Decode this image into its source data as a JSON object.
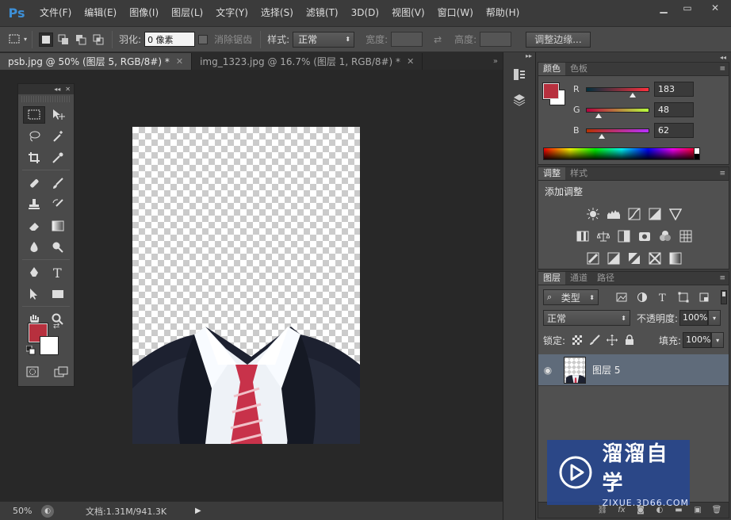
{
  "app": {
    "logo": "Ps",
    "menu": [
      "文件(F)",
      "编辑(E)",
      "图像(I)",
      "图层(L)",
      "文字(Y)",
      "选择(S)",
      "滤镜(T)",
      "3D(D)",
      "视图(V)",
      "窗口(W)",
      "帮助(H)"
    ],
    "window_controls": {
      "minimize": "▁",
      "restore": "▭",
      "close": "✕"
    }
  },
  "options": {
    "feather_label": "羽化:",
    "feather_value": "0 像素",
    "antialias_label": "消除锯齿",
    "style_label": "样式:",
    "style_value": "正常",
    "width_label": "宽度:",
    "height_label": "高度:",
    "refine_edge_button": "调整边缘..."
  },
  "doc_tabs": [
    {
      "label": "psb.jpg @ 50% (图层 5, RGB/8#) *",
      "active": true
    },
    {
      "label": "img_1323.jpg @ 16.7% (图层 1, RGB/8#) *",
      "active": false
    }
  ],
  "status": {
    "zoom": "50%",
    "doc_info": "文档:1.31M/941.3K"
  },
  "colors": {
    "foreground": "#b7303e",
    "background": "#ffffff",
    "accent": "#5f6b7a"
  },
  "color_panel": {
    "tabs": [
      "颜色",
      "色板"
    ],
    "r_label": "R",
    "r_value": "183",
    "g_label": "G",
    "g_value": "48",
    "b_label": "B",
    "b_value": "62"
  },
  "adjust_panel": {
    "tabs": [
      "调整",
      "样式"
    ],
    "title": "添加调整"
  },
  "layers_panel": {
    "tabs": [
      "图层",
      "通道",
      "路径"
    ],
    "filter_kind": "类型",
    "blend_mode": "正常",
    "opacity_label": "不透明度:",
    "opacity_value": "100%",
    "lock_label": "锁定:",
    "fill_label": "填充:",
    "fill_value": "100%",
    "layers": [
      {
        "name": "图层 5",
        "visible": true,
        "selected": true
      }
    ]
  },
  "watermark": {
    "title": "溜溜自学",
    "url": "ZIXUE.3D66.COM"
  }
}
